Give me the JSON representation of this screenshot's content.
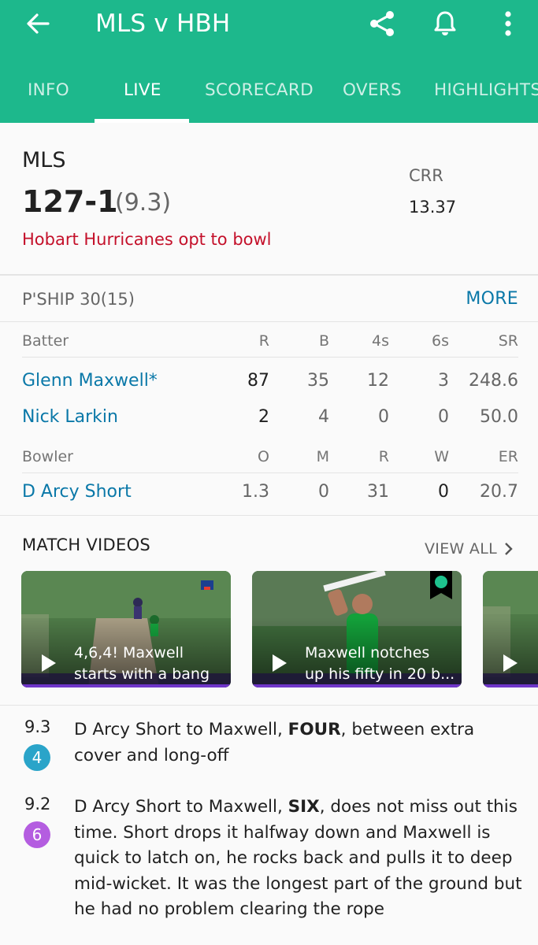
{
  "header": {
    "title": "MLS v HBH",
    "icons": [
      "back-arrow-icon",
      "share-icon",
      "bell-icon",
      "more-vert-icon"
    ],
    "tabs": [
      {
        "label": "INFO"
      },
      {
        "label": "LIVE"
      },
      {
        "label": "SCORECARD"
      },
      {
        "label": "OVERS"
      },
      {
        "label": "HIGHLIGHTS"
      }
    ],
    "active_tab": "LIVE"
  },
  "score": {
    "team": "MLS",
    "runs": "127-1",
    "overs": "(9.3)",
    "crr_label": "CRR",
    "crr_value": "13.37",
    "toss": "Hobart Hurricanes opt to bowl"
  },
  "partnership": {
    "label": "P'SHIP 30(15)",
    "more": "MORE"
  },
  "batting": {
    "headers": [
      "Batter",
      "R",
      "B",
      "4s",
      "6s",
      "SR"
    ],
    "rows": [
      {
        "name": "Glenn Maxwell*",
        "r": "87",
        "b": "35",
        "fours": "12",
        "sixes": "3",
        "sr": "248.6"
      },
      {
        "name": "Nick Larkin",
        "r": "2",
        "b": "4",
        "fours": "0",
        "sixes": "0",
        "sr": "50.0"
      }
    ]
  },
  "bowling": {
    "headers": [
      "Bowler",
      "O",
      "M",
      "R",
      "W",
      "ER"
    ],
    "rows": [
      {
        "name": "D Arcy Short",
        "o": "1.3",
        "m": "0",
        "r": "31",
        "w": "0",
        "er": "20.7"
      }
    ]
  },
  "videos": {
    "title": "MATCH VIDEOS",
    "view_all": "VIEW ALL",
    "items": [
      {
        "caption_line1": "4,6,4! Maxwell",
        "caption_line2": "starts with a bang"
      },
      {
        "caption_line1": "Maxwell notches",
        "caption_line2": "up his fifty in 20 b..."
      }
    ]
  },
  "commentary": [
    {
      "over": "9.3",
      "result": "4",
      "result_color": "#2aa4c9",
      "lead": "D Arcy Short to Maxwell, ",
      "event": "FOUR",
      "text": ", between extra cover and long-off"
    },
    {
      "over": "9.2",
      "result": "6",
      "result_color": "#b45de0",
      "lead": "D Arcy Short to Maxwell, ",
      "event": "SIX",
      "text": ", does not miss out this time. Short drops it halfway down and Maxwell is quick to latch on, he rocks back and pulls it to deep mid-wicket. It was the longest part of the ground but he had no problem clearing the rope"
    }
  ],
  "colors": {
    "brand": "#1db88c",
    "link": "#0a78a8",
    "alert": "#c4102a"
  }
}
